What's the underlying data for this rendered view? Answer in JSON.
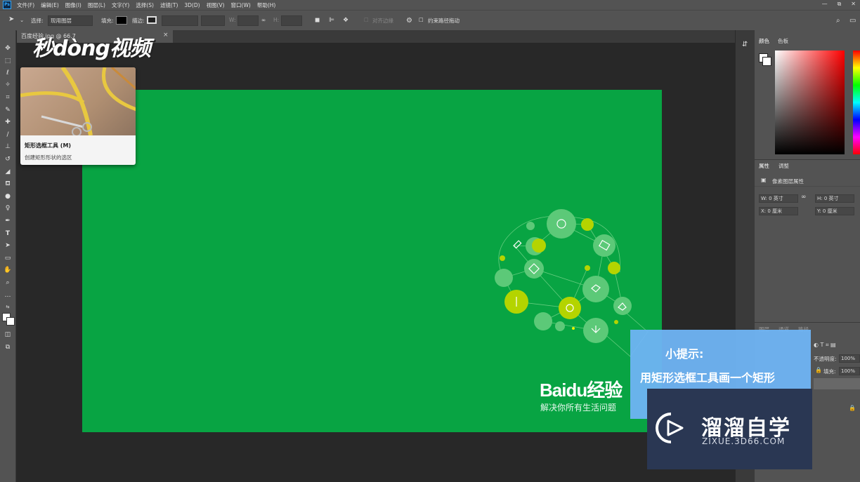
{
  "menu": {
    "app_icon": "Ps",
    "items": [
      "文件(F)",
      "编辑(E)",
      "图像(I)",
      "图层(L)",
      "文字(Y)",
      "选择(S)",
      "滤镜(T)",
      "3D(D)",
      "视图(V)",
      "窗口(W)",
      "帮助(H)"
    ]
  },
  "window_controls": {
    "minimize": "—",
    "restore": "⧉",
    "close": "✕"
  },
  "options": {
    "select_label": "选择:",
    "select_value": "现用图层",
    "fill_label": "填充:",
    "stroke_label": "描边:",
    "w_label": "W:",
    "h_label": "H:",
    "align_edges_label": "对齐边缘",
    "constrain_label": "约束路径拖动"
  },
  "document_tab": {
    "name": "百度经验.jpg @ 66.7",
    "close": "×"
  },
  "watermark_logo": "秒dòng视频",
  "tooltip_card": {
    "title": "矩形选框工具 (M)",
    "description": "创建矩形形状的选区"
  },
  "baidu": {
    "brand": "Baidu经验",
    "slogan": "解决你所有生活问题"
  },
  "color_panel": {
    "tabs": [
      "颜色",
      "色板"
    ],
    "colors": {
      "fg": "#ffffff",
      "bg": "#000000",
      "artboard": "#08a443"
    }
  },
  "properties_panel": {
    "tabs": [
      "属性",
      "调整"
    ],
    "header": "像素图层属性",
    "w": "W: 0 英寸",
    "h": "H: 0 英寸",
    "x": "X: 0 厘米",
    "y": "Y: 0 厘米"
  },
  "layers_panel": {
    "tabs": [
      "图层",
      "通道",
      "路径"
    ],
    "opacity_label": "不透明度:",
    "opacity_value": "100%",
    "fill_label": "填充:",
    "fill_value": "100%"
  },
  "hint": {
    "title": "小提示:",
    "text": "用矩形选框工具画一个矩形"
  },
  "zixue": {
    "name": "溜溜自学",
    "url": "ZIXUE.3D66.COM"
  }
}
